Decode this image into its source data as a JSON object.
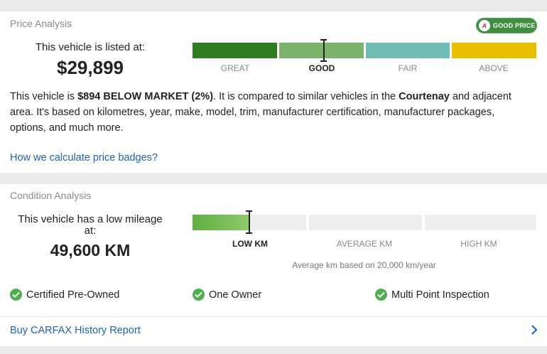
{
  "price": {
    "title": "Price Analysis",
    "badge": {
      "text": "GOOD PRICE",
      "logo": "A"
    },
    "listed_label": "This vehicle is listed at:",
    "price": "$29,899",
    "scale": [
      {
        "label": "GREAT",
        "color": "#2e7d1e",
        "active": false
      },
      {
        "label": "GOOD",
        "color": "#7bb36a",
        "active": true
      },
      {
        "label": "FAIR",
        "color": "#6fbdb5",
        "active": false
      },
      {
        "label": "ABOVE",
        "color": "#e8c000",
        "active": false
      }
    ],
    "description": {
      "part1": "This vehicle is ",
      "bold1": "$894 BELOW MARKET (2%)",
      "part2": ". It is compared to similar vehicles in the ",
      "bold2": "Courtenay",
      "part3": " and adjacent area. It's based on kilometres, year, make, model, trim, manufacturer certification, manufacturer packages, options, and much more."
    },
    "link": "How we calculate price badges?"
  },
  "condition": {
    "title": "Condition Analysis",
    "mileage_label": "This vehicle has a low mileage at:",
    "mileage": "49,600 KM",
    "scale": [
      {
        "label": "LOW KM",
        "active": true
      },
      {
        "label": "AVERAGE KM",
        "active": false
      },
      {
        "label": "HIGH KM",
        "active": false
      }
    ],
    "low_km_fill": 0.5,
    "avg_note": "Average km based on 20,000 km/year",
    "features": [
      "Certified Pre-Owned",
      "One Owner",
      "Multi Point Inspection"
    ],
    "report_link": "Buy CARFAX History Report"
  },
  "colors": {
    "accent_link": "#1a63b8",
    "check_green": "#4caf50",
    "low_km_gradient": [
      "#5fae3e",
      "#8fcb6a"
    ],
    "empty_segment": "#eeeeee"
  }
}
